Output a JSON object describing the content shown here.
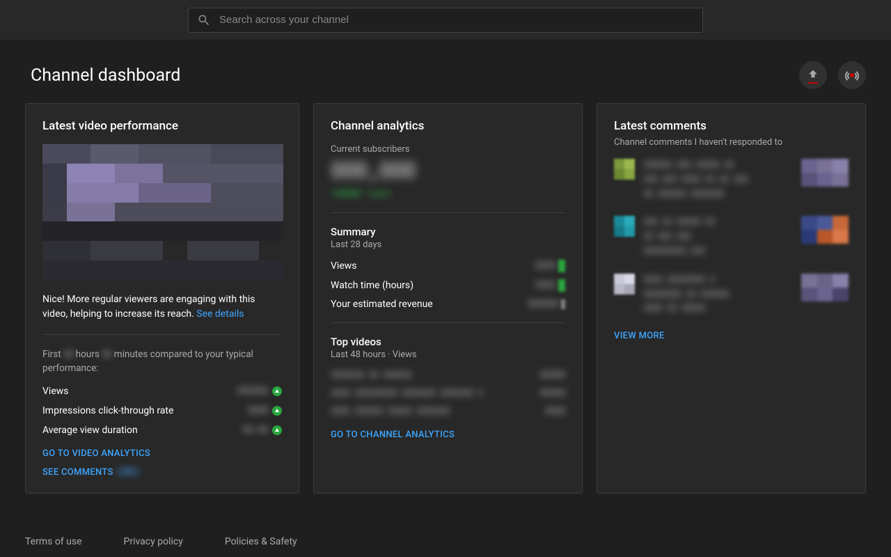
{
  "header": {
    "search_placeholder": "Search across your channel"
  },
  "page": {
    "title": "Channel dashboard"
  },
  "latest": {
    "card_title": "Latest video performance",
    "perf_text": "Nice! More regular viewers are engaging with this video, helping to increase its reach. ",
    "see_details": "See details",
    "first_prefix": "First ",
    "first_mid": " hours ",
    "first_suffix": " minutes compared to your typical performance:",
    "views_label": "Views",
    "ctr_label": "Impressions click-through rate",
    "avd_label": "Average view duration",
    "go_analytics": "GO TO VIDEO ANALYTICS",
    "see_comments": "SEE COMMENTS "
  },
  "analytics": {
    "card_title": "Channel analytics",
    "current_subs_label": "Current subscribers",
    "summary_label": "Summary",
    "summary_period": "Last 28 days",
    "views_label": "Views",
    "watch_label": "Watch time (hours)",
    "revenue_label": "Your estimated revenue",
    "top_videos_label": "Top videos",
    "top_videos_period": "Last 48 hours · Views",
    "go_channel": "GO TO CHANNEL ANALYTICS"
  },
  "comments": {
    "card_title": "Latest comments",
    "subtitle": "Channel comments I haven't responded to",
    "view_more": "VIEW MORE"
  },
  "footer": {
    "terms": "Terms of use",
    "privacy": "Privacy policy",
    "policies": "Policies & Safety"
  }
}
